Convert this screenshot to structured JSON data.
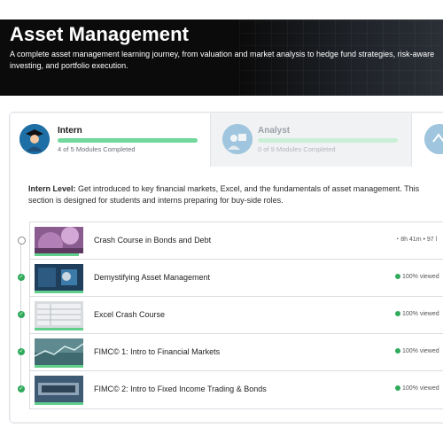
{
  "hero": {
    "title": "Asset Management",
    "description": "A complete asset management learning journey, from valuation and market analysis to hedge fund strategies, risk-aware investing, and portfolio execution."
  },
  "levels": [
    {
      "title": "Intern",
      "progress_text": "4 of 5 Modules Completed",
      "progress_fraction": 0.8,
      "icon": "intern-graduate-icon"
    },
    {
      "title": "Analyst",
      "progress_text": "0 of 9 Modules Completed",
      "progress_fraction": 0,
      "icon": "analyst-chart-icon"
    }
  ],
  "level_description": {
    "label": "Intern Level:",
    "text": "Get introduced to key financial markets, Excel, and the fundamentals of asset management. This section is designed for students and interns preparing for buy-side roles."
  },
  "modules": [
    {
      "title": "Crash Course in Bonds and Debt",
      "meta": "8h 41m • 97 l",
      "completed": false
    },
    {
      "title": "Demystifying Asset Management",
      "meta": "100% viewed",
      "completed": true
    },
    {
      "title": "Excel Crash Course",
      "meta": "100% viewed",
      "completed": true
    },
    {
      "title": "FIMC© 1: Intro to Financial Markets",
      "meta": "100% viewed",
      "completed": true
    },
    {
      "title": "FIMC© 2: Intro to Fixed Income Trading & Bonds",
      "meta": "100% viewed",
      "completed": true
    }
  ],
  "colors": {
    "accent": "#6fd89a",
    "complete": "#2faa5a",
    "hero_bg": "#0b0b0b",
    "icon_active": "#1d6fa5"
  }
}
